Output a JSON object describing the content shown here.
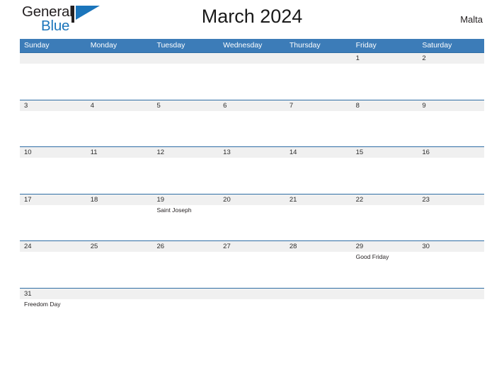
{
  "brand": {
    "name_part1": "General",
    "name_part2": "Blue",
    "mark_icon": "blue-flag-triangle-icon"
  },
  "header": {
    "title": "March 2024",
    "region": "Malta"
  },
  "colors": {
    "header_blue": "#3c7cb8",
    "row_divider_blue": "#2e6da4",
    "date_band_gray": "#f0f0f0",
    "brand_blue": "#1b75bb",
    "text_dark": "#231f20"
  },
  "calendar": {
    "weekdays": [
      "Sunday",
      "Monday",
      "Tuesday",
      "Wednesday",
      "Thursday",
      "Friday",
      "Saturday"
    ],
    "weeks": [
      [
        {
          "date": "",
          "event": ""
        },
        {
          "date": "",
          "event": ""
        },
        {
          "date": "",
          "event": ""
        },
        {
          "date": "",
          "event": ""
        },
        {
          "date": "",
          "event": ""
        },
        {
          "date": "1",
          "event": ""
        },
        {
          "date": "2",
          "event": ""
        }
      ],
      [
        {
          "date": "3",
          "event": ""
        },
        {
          "date": "4",
          "event": ""
        },
        {
          "date": "5",
          "event": ""
        },
        {
          "date": "6",
          "event": ""
        },
        {
          "date": "7",
          "event": ""
        },
        {
          "date": "8",
          "event": ""
        },
        {
          "date": "9",
          "event": ""
        }
      ],
      [
        {
          "date": "10",
          "event": ""
        },
        {
          "date": "11",
          "event": ""
        },
        {
          "date": "12",
          "event": ""
        },
        {
          "date": "13",
          "event": ""
        },
        {
          "date": "14",
          "event": ""
        },
        {
          "date": "15",
          "event": ""
        },
        {
          "date": "16",
          "event": ""
        }
      ],
      [
        {
          "date": "17",
          "event": ""
        },
        {
          "date": "18",
          "event": ""
        },
        {
          "date": "19",
          "event": "Saint Joseph"
        },
        {
          "date": "20",
          "event": ""
        },
        {
          "date": "21",
          "event": ""
        },
        {
          "date": "22",
          "event": ""
        },
        {
          "date": "23",
          "event": ""
        }
      ],
      [
        {
          "date": "24",
          "event": ""
        },
        {
          "date": "25",
          "event": ""
        },
        {
          "date": "26",
          "event": ""
        },
        {
          "date": "27",
          "event": ""
        },
        {
          "date": "28",
          "event": ""
        },
        {
          "date": "29",
          "event": "Good Friday"
        },
        {
          "date": "30",
          "event": ""
        }
      ],
      [
        {
          "date": "31",
          "event": "Freedom Day"
        },
        {
          "date": "",
          "event": ""
        },
        {
          "date": "",
          "event": ""
        },
        {
          "date": "",
          "event": ""
        },
        {
          "date": "",
          "event": ""
        },
        {
          "date": "",
          "event": ""
        },
        {
          "date": "",
          "event": ""
        }
      ]
    ]
  }
}
